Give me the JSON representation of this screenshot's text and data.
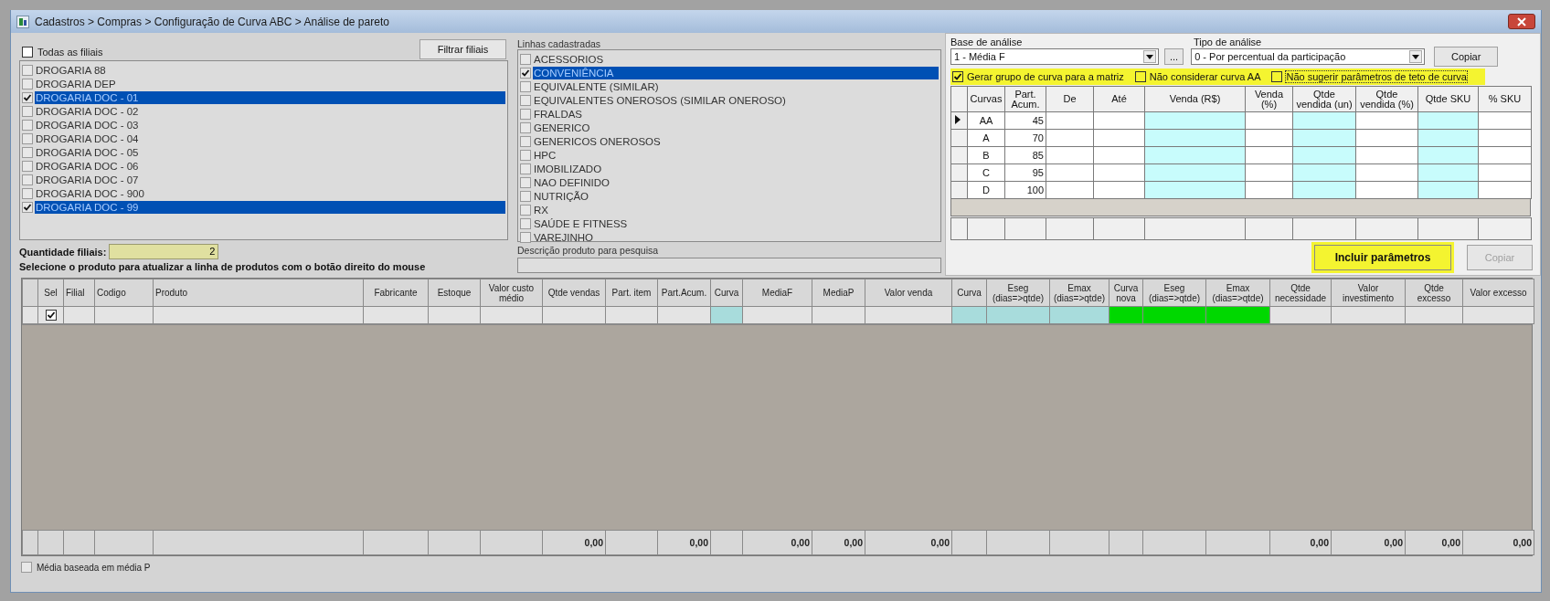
{
  "window": {
    "title": "Cadastros > Compras > Configuração de Curva ABC > Análise de pareto"
  },
  "filiais": {
    "all_label": "Todas as filiais",
    "all_checked": false,
    "filter_button": "Filtrar filiais",
    "items": [
      {
        "label": "DROGARIA 88",
        "checked": false,
        "selected": false
      },
      {
        "label": "DROGARIA DEP",
        "checked": false,
        "selected": false
      },
      {
        "label": "DROGARIA DOC - 01",
        "checked": true,
        "selected": true
      },
      {
        "label": "DROGARIA DOC - 02",
        "checked": false,
        "selected": false
      },
      {
        "label": "DROGARIA DOC - 03",
        "checked": false,
        "selected": false
      },
      {
        "label": "DROGARIA DOC - 04",
        "checked": false,
        "selected": false
      },
      {
        "label": "DROGARIA DOC - 05",
        "checked": false,
        "selected": false
      },
      {
        "label": "DROGARIA DOC - 06",
        "checked": false,
        "selected": false
      },
      {
        "label": "DROGARIA DOC - 07",
        "checked": false,
        "selected": false
      },
      {
        "label": "DROGARIA DOC - 900",
        "checked": false,
        "selected": false
      },
      {
        "label": "DROGARIA DOC - 99",
        "checked": true,
        "selected": true
      }
    ],
    "count_label": "Quantidade filiais:",
    "count_value": "2"
  },
  "hint": "Selecione o produto para atualizar a linha de produtos com o botão direito do mouse",
  "linhas": {
    "label": "Linhas cadastradas",
    "items": [
      {
        "label": "ACESSORIOS",
        "checked": false,
        "selected": false
      },
      {
        "label": "CONVENIÊNCIA",
        "checked": true,
        "selected": true
      },
      {
        "label": "EQUIVALENTE (SIMILAR)",
        "checked": false,
        "selected": false
      },
      {
        "label": "EQUIVALENTES ONEROSOS (SIMILAR ONEROSO)",
        "checked": false,
        "selected": false
      },
      {
        "label": "FRALDAS",
        "checked": false,
        "selected": false
      },
      {
        "label": "GENERICO",
        "checked": false,
        "selected": false
      },
      {
        "label": "GENERICOS ONEROSOS",
        "checked": false,
        "selected": false
      },
      {
        "label": "HPC",
        "checked": false,
        "selected": false
      },
      {
        "label": "IMOBILIZADO",
        "checked": false,
        "selected": false
      },
      {
        "label": "NAO DEFINIDO",
        "checked": false,
        "selected": false
      },
      {
        "label": "NUTRIÇÃO",
        "checked": false,
        "selected": false
      },
      {
        "label": "RX",
        "checked": false,
        "selected": false
      },
      {
        "label": "SAÚDE E FITNESS",
        "checked": false,
        "selected": false
      },
      {
        "label": "VAREJINHO",
        "checked": false,
        "selected": false
      }
    ],
    "search_label": "Descrição produto para pesquisa"
  },
  "analise": {
    "base_label": "Base de análise",
    "base_value": "1 - Média F",
    "more_button": "...",
    "tipo_label": "Tipo de análise",
    "tipo_value": "0 - Por percentual da participação",
    "copy_button": {
      "label": "Copiar",
      "disabled": false
    },
    "options": [
      {
        "label": "Gerar grupo de curva para a matriz",
        "checked": true
      },
      {
        "label": "Não considerar curva AA",
        "checked": false
      },
      {
        "label": "Não sugerir parâmetros de teto de curva",
        "checked": false
      }
    ],
    "curves": {
      "columns": [
        {
          "label": "Curvas",
          "color": "#ffffff"
        },
        {
          "label": "Part. Acum.",
          "color": "#ffffff"
        },
        {
          "label": "De",
          "color": "#ffffff"
        },
        {
          "label": "Até",
          "color": "#ffffff"
        },
        {
          "label": "Venda (R$)",
          "color": "#c8fcfc"
        },
        {
          "label": "Venda (%)",
          "color": "#ffffff"
        },
        {
          "label": "Qtde vendida (un)",
          "color": "#c8fcfc"
        },
        {
          "label": "Qtde vendida (%)",
          "color": "#ffffff"
        },
        {
          "label": "Qtde SKU",
          "color": "#c8fcfc"
        },
        {
          "label": "% SKU",
          "color": "#ffffff"
        }
      ],
      "rows": [
        {
          "curve": "AA",
          "part": "45",
          "current": true
        },
        {
          "curve": "A",
          "part": "70",
          "current": false
        },
        {
          "curve": "B",
          "part": "85",
          "current": false
        },
        {
          "curve": "C",
          "part": "95",
          "current": false
        },
        {
          "curve": "D",
          "part": "100",
          "current": false
        }
      ]
    },
    "include_button": {
      "label": "Incluir parâmetros",
      "disabled": false
    },
    "copy_button_2": {
      "label": "Copiar",
      "disabled": true
    }
  },
  "grid": {
    "columns": [
      {
        "label": "Sel",
        "kind": "check",
        "color": "#e4e4e4"
      },
      {
        "label": "Filial",
        "kind": "text",
        "color": "#e4e4e4"
      },
      {
        "label": "Codigo",
        "kind": "text",
        "color": "#e4e4e4"
      },
      {
        "label": "Produto",
        "kind": "text",
        "color": "#e4e4e4"
      },
      {
        "label": "Fabricante",
        "kind": "text",
        "color": "#e4e4e4"
      },
      {
        "label": "Estoque",
        "kind": "text",
        "color": "#e4e4e4"
      },
      {
        "label": "Valor custo médio",
        "kind": "text",
        "color": "#e4e4e4"
      },
      {
        "label": "Qtde vendas",
        "kind": "text",
        "color": "#e4e4e4",
        "total": "0,00"
      },
      {
        "label": "Part. item",
        "kind": "text",
        "color": "#e4e4e4"
      },
      {
        "label": "Part.Acum.",
        "kind": "text",
        "color": "#e4e4e4",
        "total": "0,00"
      },
      {
        "label": "Curva",
        "kind": "text",
        "color": "#a8dcdc"
      },
      {
        "label": "MediaF",
        "kind": "text",
        "color": "#e4e4e4",
        "total": "0,00"
      },
      {
        "label": "MediaP",
        "kind": "text",
        "color": "#e4e4e4",
        "total": "0,00"
      },
      {
        "label": "Valor venda",
        "kind": "text",
        "color": "#e4e4e4",
        "total": "0,00"
      },
      {
        "label": "Curva",
        "kind": "text",
        "color": "#a8dcdc"
      },
      {
        "label": "Eseg (dias=>qtde)",
        "kind": "text",
        "color": "#a8dcdc"
      },
      {
        "label": "Emax (dias=>qtde)",
        "kind": "text",
        "color": "#a8dcdc"
      },
      {
        "label": "Curva nova",
        "kind": "text",
        "color": "#00d800"
      },
      {
        "label": "Eseg (dias=>qtde)",
        "kind": "text",
        "color": "#00d800"
      },
      {
        "label": "Emax (dias=>qtde)",
        "kind": "text",
        "color": "#00d800"
      },
      {
        "label": "Qtde necessidade",
        "kind": "text",
        "color": "#e4e4e4",
        "total": "0,00"
      },
      {
        "label": "Valor investimento",
        "kind": "text",
        "color": "#e4e4e4",
        "total": "0,00"
      },
      {
        "label": "Qtde excesso",
        "kind": "text",
        "color": "#e4e4e4",
        "total": "0,00"
      },
      {
        "label": "Valor excesso",
        "kind": "text",
        "color": "#e4e4e4",
        "total": "0,00"
      }
    ],
    "rows": [
      {
        "checked": true
      }
    ]
  },
  "footer_option": {
    "label": "Média baseada em média P",
    "checked": false
  }
}
